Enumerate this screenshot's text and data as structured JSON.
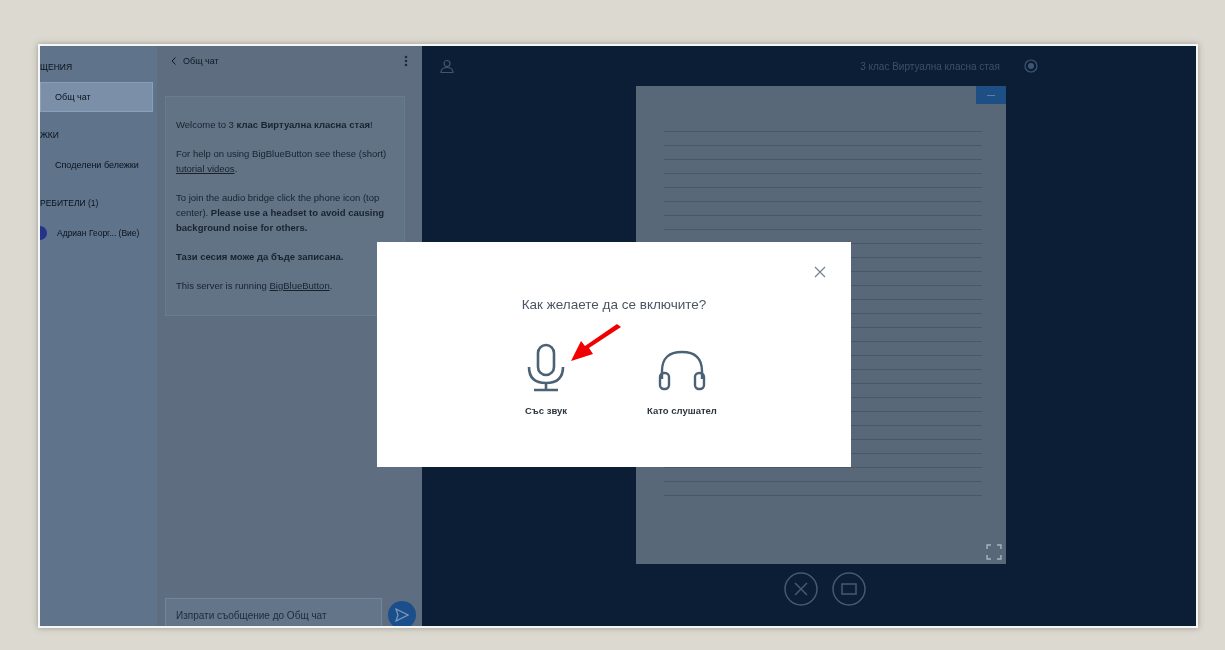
{
  "sidebar": {
    "items": [
      {
        "kind": "heading",
        "label": "ЩЕНИЯ"
      },
      {
        "kind": "item",
        "label": "Общ чат",
        "selected": true
      },
      {
        "kind": "heading",
        "label": "ЖКИ"
      },
      {
        "kind": "item",
        "label": "Споделени бележки",
        "selected": false
      },
      {
        "kind": "heading",
        "label": "РЕБИТЕЛИ (1)"
      },
      {
        "kind": "user",
        "label": "Адриан Георг... (Вие)"
      }
    ]
  },
  "chat": {
    "title": "Общ чат",
    "messages": [
      [
        {
          "kind": "text",
          "text": "Welcome to 3 **клас Виртуална класна стая**!"
        }
      ],
      [
        {
          "kind": "text",
          "text": "For help on using BigBlueButton see these (short) "
        },
        {
          "kind": "link",
          "text": "tutorial videos"
        },
        {
          "kind": "text",
          "text": "."
        }
      ],
      [
        {
          "kind": "text",
          "text": "To join the audio bridge click the phone icon (top center). **Please use a headset to avoid causing background noise for others.**"
        }
      ],
      [
        {
          "kind": "text",
          "text": "**Тази сесия може да бъде записана.**"
        }
      ],
      [
        {
          "kind": "text",
          "text": "This server is running "
        },
        {
          "kind": "link",
          "text": "BigBlueButton"
        },
        {
          "kind": "text",
          "text": "."
        }
      ]
    ],
    "input": {
      "placeholder": "Изпрати съобщение до Общ чат"
    }
  },
  "main": {
    "title": "3 клас Виртуална класна стая"
  },
  "dialog": {
    "question": "Как желаете да се включите?",
    "options": [
      {
        "kind": "microphone",
        "label": "Със звук"
      },
      {
        "kind": "headphones",
        "label": "Като слушател"
      }
    ]
  }
}
